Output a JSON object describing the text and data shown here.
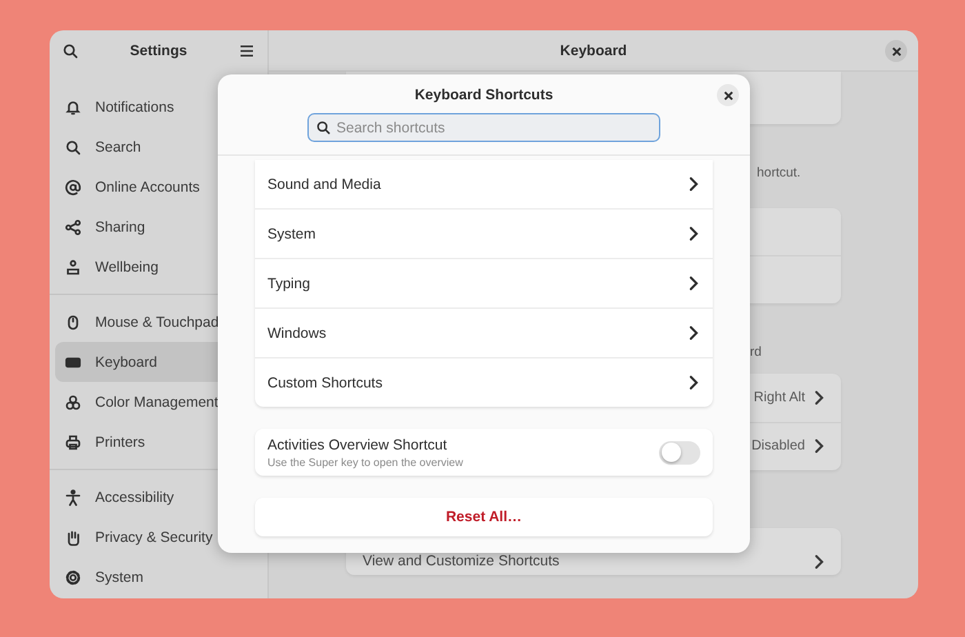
{
  "window": {
    "sidebar_title": "Settings",
    "content_title": "Keyboard"
  },
  "sidebar": {
    "sections": [
      {
        "items": [
          {
            "label": "Notifications",
            "selected": false
          },
          {
            "label": "Search",
            "selected": false
          },
          {
            "label": "Online Accounts",
            "selected": false
          },
          {
            "label": "Sharing",
            "selected": false
          },
          {
            "label": "Wellbeing",
            "selected": false
          }
        ]
      },
      {
        "items": [
          {
            "label": "Mouse & Touchpad",
            "selected": false
          },
          {
            "label": "Keyboard",
            "selected": true
          },
          {
            "label": "Color Management",
            "selected": false
          },
          {
            "label": "Printers",
            "selected": false
          }
        ]
      },
      {
        "items": [
          {
            "label": "Accessibility",
            "selected": false
          },
          {
            "label": "Privacy & Security",
            "selected": false
          },
          {
            "label": "System",
            "selected": false
          }
        ]
      }
    ]
  },
  "background": {
    "note": "hortcut.",
    "section_label": "rd",
    "rows": [
      {
        "value": "Right Alt"
      },
      {
        "value": "Disabled"
      }
    ],
    "link_row": "View and Customize Shortcuts"
  },
  "dialog": {
    "title": "Keyboard Shortcuts",
    "search": {
      "placeholder": "Search shortcuts"
    },
    "categories": [
      "Sound and Media",
      "System",
      "Typing",
      "Windows",
      "Custom Shortcuts"
    ],
    "toggle_row": {
      "title": "Activities Overview Shortcut",
      "subtitle": "Use the Super key to open the overview",
      "on": false
    },
    "reset_button": "Reset All…"
  }
}
